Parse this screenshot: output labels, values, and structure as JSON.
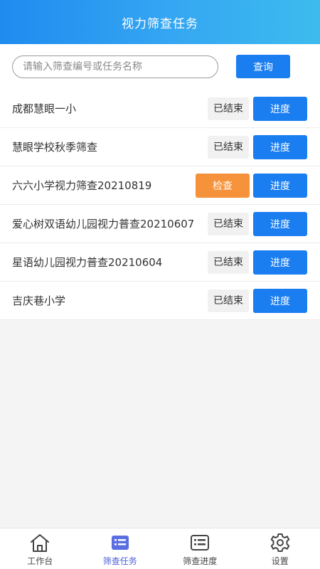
{
  "header": {
    "title": "视力筛查任务"
  },
  "search": {
    "placeholder": "请输入筛查编号或任务名称",
    "value": "",
    "button_label": "查询"
  },
  "tasks": [
    {
      "name": "成都慧眼一小",
      "status": "已结束",
      "action": "进度"
    },
    {
      "name": "慧眼学校秋季筛查",
      "status": "已结束",
      "action": "进度"
    },
    {
      "name": "六六小学视力筛查20210819",
      "check_label": "检查",
      "action": "进度"
    },
    {
      "name": "爱心树双语幼儿园视力普查20210607",
      "status": "已结束",
      "action": "进度"
    },
    {
      "name": "星语幼儿园视力普查20210604",
      "status": "已结束",
      "action": "进度"
    },
    {
      "name": "吉庆巷小学",
      "status": "已结束",
      "action": "进度"
    }
  ],
  "tabbar": {
    "items": [
      {
        "label": "工作台",
        "icon": "home-icon"
      },
      {
        "label": "筛查任务",
        "icon": "task-list-icon",
        "active": true
      },
      {
        "label": "筛查进度",
        "icon": "progress-card-icon"
      },
      {
        "label": "设置",
        "icon": "gear-icon"
      }
    ]
  },
  "colors": {
    "primary": "#1a7df0",
    "warning": "#f5923a",
    "active_tab": "#4a5fd8"
  }
}
